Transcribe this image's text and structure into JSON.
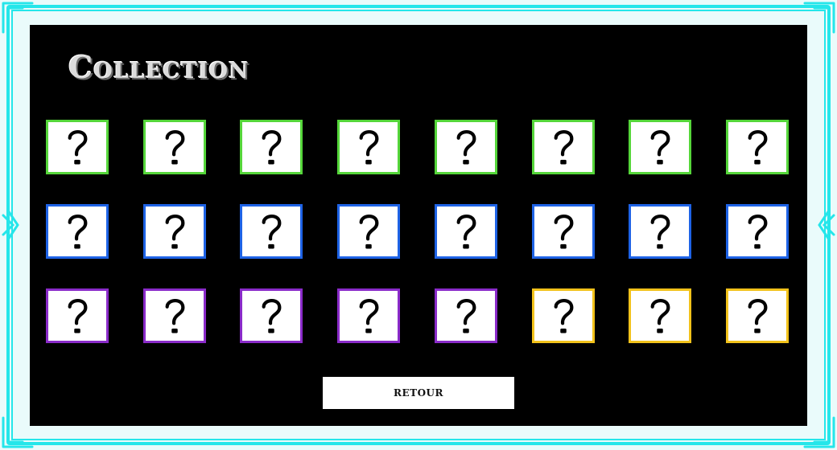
{
  "title": "Collection",
  "button": {
    "label": "RETOUR"
  },
  "cards": [
    {
      "color": "#55d63a",
      "icon": "question-mark-icon"
    },
    {
      "color": "#55d63a",
      "icon": "question-mark-icon"
    },
    {
      "color": "#55d63a",
      "icon": "question-mark-icon"
    },
    {
      "color": "#55d63a",
      "icon": "question-mark-icon"
    },
    {
      "color": "#55d63a",
      "icon": "question-mark-icon"
    },
    {
      "color": "#55d63a",
      "icon": "question-mark-icon"
    },
    {
      "color": "#55d63a",
      "icon": "question-mark-icon"
    },
    {
      "color": "#55d63a",
      "icon": "question-mark-icon"
    },
    {
      "color": "#1e63e6",
      "icon": "question-mark-icon"
    },
    {
      "color": "#1e63e6",
      "icon": "question-mark-icon"
    },
    {
      "color": "#1e63e6",
      "icon": "question-mark-icon"
    },
    {
      "color": "#1e63e6",
      "icon": "question-mark-icon"
    },
    {
      "color": "#1e63e6",
      "icon": "question-mark-icon"
    },
    {
      "color": "#1e63e6",
      "icon": "question-mark-icon"
    },
    {
      "color": "#1e63e6",
      "icon": "question-mark-icon"
    },
    {
      "color": "#1e63e6",
      "icon": "question-mark-icon"
    },
    {
      "color": "#8a2bc9",
      "icon": "question-mark-icon"
    },
    {
      "color": "#8a2bc9",
      "icon": "question-mark-icon"
    },
    {
      "color": "#8a2bc9",
      "icon": "question-mark-icon"
    },
    {
      "color": "#8a2bc9",
      "icon": "question-mark-icon"
    },
    {
      "color": "#8a2bc9",
      "icon": "question-mark-icon"
    },
    {
      "color": "#f2c21b",
      "icon": "question-mark-icon"
    },
    {
      "color": "#f2c21b",
      "icon": "question-mark-icon"
    },
    {
      "color": "#f2c21b",
      "icon": "question-mark-icon"
    }
  ],
  "colors": {
    "frame": "#25e6ea",
    "panel": "#000000"
  }
}
